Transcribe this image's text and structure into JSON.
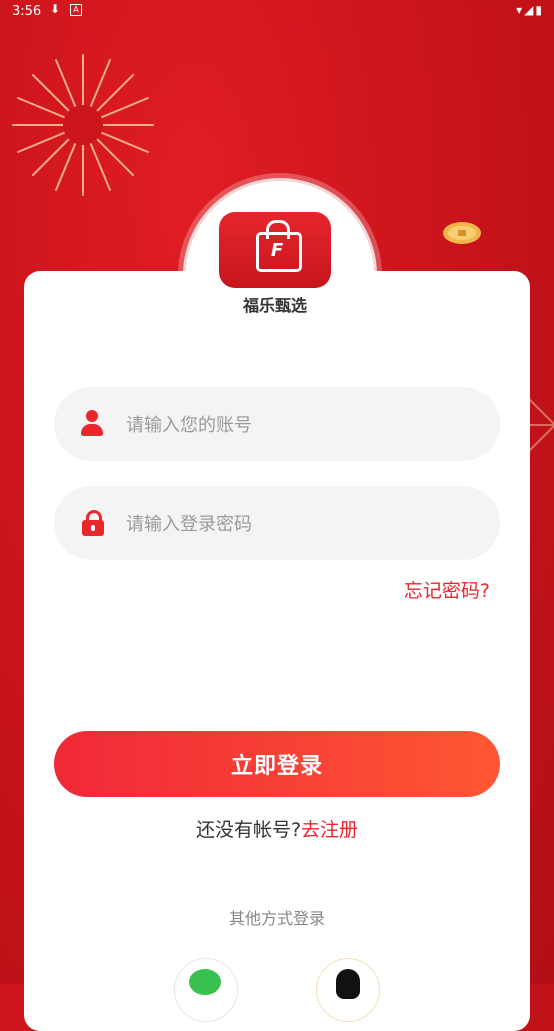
{
  "status_bar": {
    "time": "3:56",
    "download": "⬇",
    "a_label": "A",
    "right_icons": "▾◢▮"
  },
  "brand": {
    "name": "福乐甄选",
    "logo_letter": "F"
  },
  "login": {
    "account_placeholder": "请输入您的账号",
    "password_placeholder": "请输入登录密码",
    "forgot_label": "忘记密码?",
    "login_label": "立即登录",
    "no_account_text": "还没有帐号?",
    "register_label": "去注册",
    "other_methods_label": "其他方式登录"
  },
  "social": [
    {
      "name": "wechat"
    },
    {
      "name": "qq"
    }
  ],
  "colors": {
    "brand_red": "#e8262c",
    "button_gradient_start": "#f02838",
    "button_gradient_end": "#ff5733"
  }
}
